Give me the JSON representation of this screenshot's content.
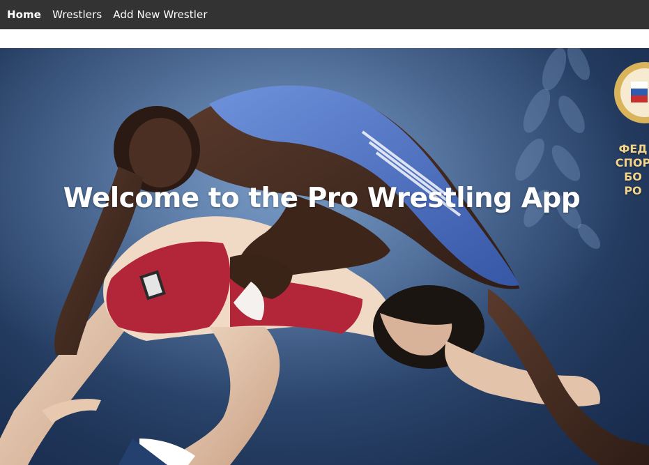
{
  "nav": {
    "items": [
      {
        "label": "Home",
        "active": true
      },
      {
        "label": "Wrestlers",
        "active": false
      },
      {
        "label": "Add New Wrestler",
        "active": false
      }
    ]
  },
  "hero": {
    "title": "Welcome to the Pro Wrestling App",
    "emblem_lines": [
      "ФЕД",
      "СПОР",
      "БО",
      "РО"
    ],
    "image": "two-wrestlers-grappling-photo"
  },
  "colors": {
    "navbar": "#333333",
    "nav_text": "#ffffff",
    "hero_bg": "#2c4670",
    "blue_singlet": "#4a6fc4",
    "red_singlet": "#b3263a",
    "emblem_gold": "#d9b45a"
  }
}
